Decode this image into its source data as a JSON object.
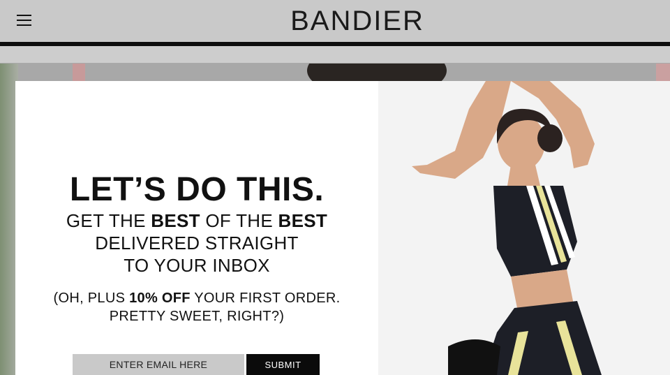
{
  "header": {
    "menu_icon": "hamburger-menu-icon",
    "logo": "BANDIER"
  },
  "modal": {
    "headline": "LET’S DO THIS.",
    "subhead": {
      "line1_pre": "GET THE ",
      "line1_b1": "BEST",
      "line1_mid": " OF THE ",
      "line1_b2": "BEST",
      "line2": "DELIVERED STRAIGHT",
      "line3": "TO YOUR INBOX"
    },
    "offer": {
      "pre": "(OH, PLUS ",
      "bold": "10% OFF",
      "post": " YOUR FIRST ORDER.",
      "line2": "PRETTY SWEET, RIGHT?)"
    },
    "email_placeholder": "ENTER EMAIL HERE",
    "submit_label": "SUBMIT"
  },
  "colors": {
    "header_bg": "#c9c9c9",
    "submit_bg": "#0b0b0b",
    "input_bg": "#c9c9c9",
    "accent_stripe": "#e8e39a"
  }
}
